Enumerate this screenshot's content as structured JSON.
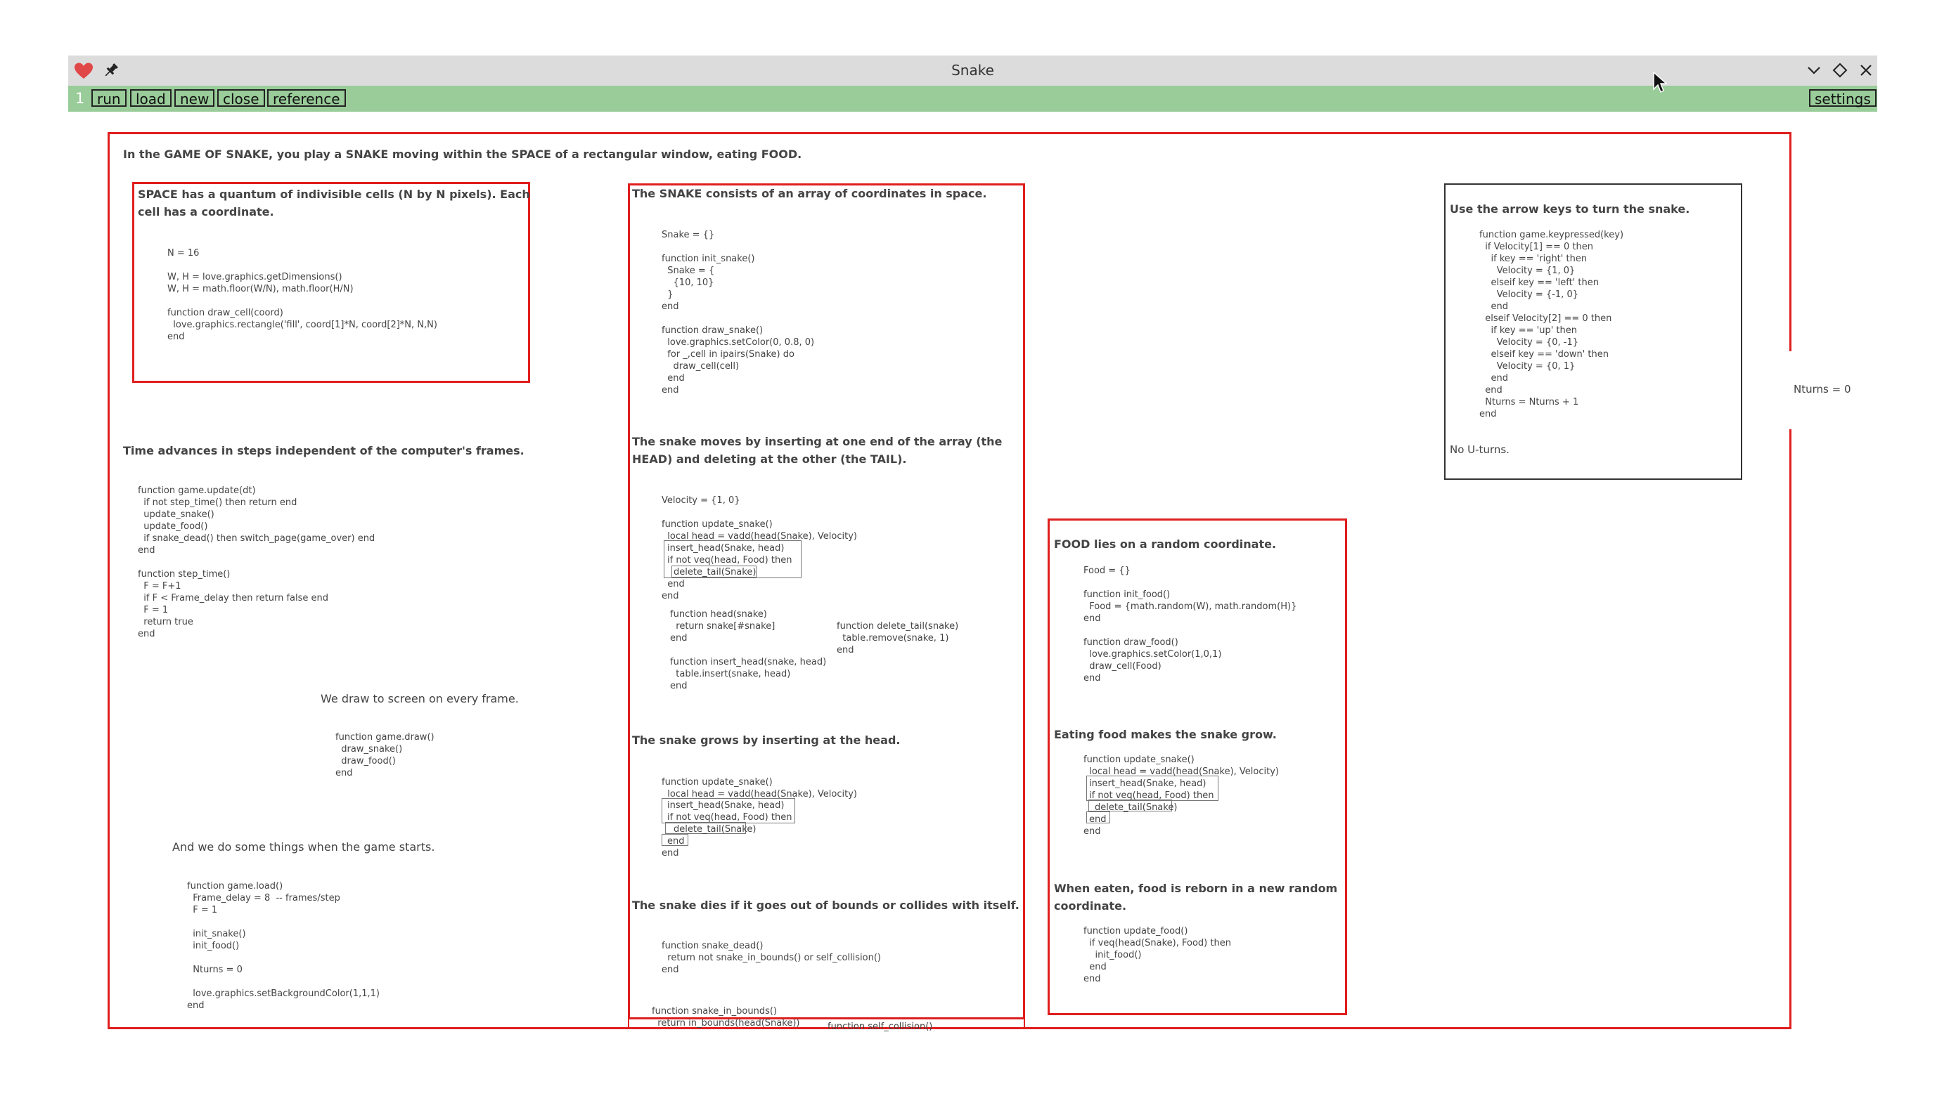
{
  "window": {
    "title": "Snake",
    "icons": [
      "heart-icon",
      "pin-icon",
      "chevron-down-icon",
      "diamond-icon",
      "close-icon"
    ],
    "colors": {
      "titlebar": "#dcdcdc",
      "toolbar": "#99cc99",
      "box_red": "#e01e1e",
      "heart": "#e04848"
    }
  },
  "toolbar": {
    "page_number": "1",
    "run": "run",
    "load": "load",
    "new": "new",
    "close": "close",
    "reference": "reference",
    "settings": "settings"
  },
  "canvas": {
    "intro": "In the GAME OF SNAKE, you play a SNAKE moving within the SPACE of a rectangular window, eating FOOD.",
    "space": {
      "heading": "SPACE has a quantum of indivisible cells (N by N pixels). Each\ncell has a coordinate.",
      "code": "N = 16\n\nW, H = love.graphics.getDimensions()\nW, H = math.floor(W/N), math.floor(H/N)\n\nfunction draw_cell(coord)\n  love.graphics.rectangle('fill', coord[1]*N, coord[2]*N, N,N)\nend"
    },
    "time": {
      "heading": "Time advances in steps independent of the computer's frames.",
      "code": "function game.update(dt)\n  if not step_time() then return end\n  update_snake()\n  update_food()\n  if snake_dead() then switch_page(game_over) end\nend\n\nfunction step_time()\n  F = F+1\n  if F < Frame_delay then return false end\n  F = 1\n  return true\nend"
    },
    "draw": {
      "text": "We draw to screen on every frame.",
      "code": "function game.draw()\n  draw_snake()\n  draw_food()\nend"
    },
    "load": {
      "text": "And we do some things when the game starts.",
      "code": "function game.load()\n  Frame_delay = 8  -- frames/step\n  F = 1\n\n  init_snake()\n  init_food()\n\n  Nturns = 0\n\n  love.graphics.setBackgroundColor(1,1,1)\nend"
    },
    "snake": {
      "heading1": "The SNAKE consists of an array of coordinates in space.",
      "code1": "Snake = {}\n\nfunction init_snake()\n  Snake = {\n    {10, 10}\n  }\nend\n\nfunction draw_snake()\n  love.graphics.setColor(0, 0.8, 0)\n  for _,cell in ipairs(Snake) do\n    draw_cell(cell)\n  end\nend",
      "heading2": "The snake moves by inserting at one end of the array (the\nHEAD) and deleting at the other (the TAIL).",
      "code2_top": "Velocity = {1, 0}\n\nfunction update_snake()\n  local head = vadd(head(Snake), Velocity)",
      "code2_hl1": "insert_head(Snake, head)",
      "code2_hl2": "if not veq(head, Food) then",
      "code2_hl3": "delete_tail(Snake)",
      "code2_end": "  end\nend",
      "code2_left": "function head(snake)\n  return snake[#snake]\nend\n\nfunction insert_head(snake, head)\n  table.insert(snake, head)\nend",
      "code2_right": "function delete_tail(snake)\n  table.remove(snake, 1)\nend",
      "heading3": "The snake grows by inserting at the head.",
      "code3_top": "function update_snake()\n  local head = vadd(head(Snake), Velocity)",
      "code3_hl1": "insert_head(Snake, head)",
      "code3_hl2": "if not veq(head, Food) then",
      "code3_hl3": "delete_tail(Snake)",
      "code3_hl4": "end",
      "code3_end": "end",
      "heading4": "The snake dies if it goes out of bounds or collides with itself.",
      "code4": "function snake_dead()\n  return not snake_in_bounds() or self_collision()\nend",
      "code5": "function snake_in_bounds()\n  return in_bounds(head(Snake))",
      "code6": "function self_collision()"
    },
    "food": {
      "heading1": "FOOD lies on a random coordinate.",
      "code1": "Food = {}\n\nfunction init_food()\n  Food = {math.random(W), math.random(H)}\nend\n\nfunction draw_food()\n  love.graphics.setColor(1,0,1)\n  draw_cell(Food)\nend",
      "heading2": "Eating food makes the snake grow.",
      "code2_top": "function update_snake()\n  local head = vadd(head(Snake), Velocity)",
      "code2_hl1": "insert_head(Snake, head)",
      "code2_hl2": "if not veq(head, Food) then",
      "code2_hl3": "delete_tail(Snake)",
      "code2_hl4": "end",
      "code2_end": "end",
      "heading3": "When eaten, food is reborn in a new random\ncoordinate.",
      "code3": "function update_food()\n  if veq(head(Snake), Food) then\n    init_food()\n  end\nend"
    },
    "keys": {
      "heading": "Use the arrow keys to turn the snake.",
      "code": "function game.keypressed(key)\n  if Velocity[1] == 0 then\n    if key == 'right' then\n      Velocity = {1, 0}\n    elseif key == 'left' then\n      Velocity = {-1, 0}\n    end\n  elseif Velocity[2] == 0 then\n    if key == 'up' then\n      Velocity = {0, -1}\n    elseif key == 'down' then\n      Velocity = {0, 1}\n    end\n  end\n  Nturns = Nturns + 1\nend",
      "footer": "No U-turns."
    },
    "nturns": "Nturns = 0"
  }
}
